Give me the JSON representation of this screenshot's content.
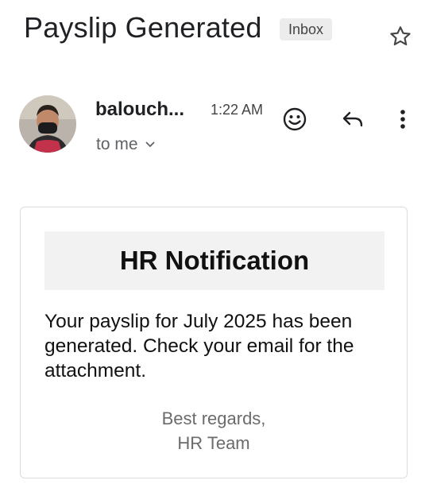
{
  "email": {
    "subject": "Payslip Generated",
    "label": "Inbox",
    "sender": "balouch...",
    "time": "1:22 AM",
    "recipient": "to me"
  },
  "message": {
    "heading": "HR Notification",
    "body": "Your payslip for July 2025 has been generated. Check your email for the attachment.",
    "signoff": "Best regards,",
    "signature": "HR Team"
  },
  "icons": {
    "star": "star-outline-icon",
    "emoji": "add-reaction-icon",
    "reply": "reply-icon",
    "more": "more-vertical-icon",
    "expand": "chevron-down-icon"
  }
}
